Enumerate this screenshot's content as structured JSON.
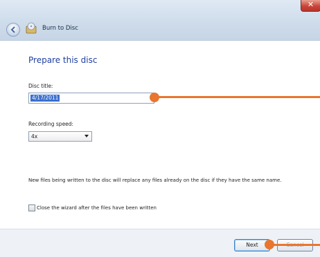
{
  "window": {
    "title": "Burn to Disc",
    "close_glyph": "✕"
  },
  "page": {
    "heading": "Prepare this disc"
  },
  "form": {
    "disc_title_label": "Disc title:",
    "disc_title_value": "4/17/2011",
    "speed_label": "Recording speed:",
    "speed_value": "4x"
  },
  "info_text": "New files being written to the disc will replace any files already on the disc if they have the same name.",
  "close_wizard": {
    "label": "Close the wizard after the files have been written",
    "checked": false
  },
  "buttons": {
    "next": "Next",
    "cancel": "Cancel"
  },
  "colors": {
    "heading": "#1f3f9f",
    "callout": "#e8762e",
    "selection": "#3a6fcf"
  },
  "icons": [
    "back-arrow-icon",
    "disc-burn-icon",
    "close-icon",
    "dropdown-arrow-icon"
  ]
}
